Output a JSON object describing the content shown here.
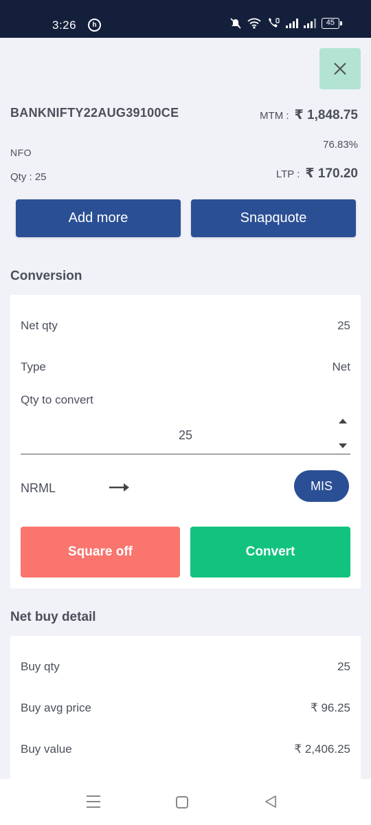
{
  "status_bar": {
    "time": "3:26",
    "app_icon_glyph": "h",
    "battery": "45",
    "icons": [
      "mute-icon",
      "wifi-icon",
      "call-icon",
      "signal-icon",
      "signal-icon",
      "battery-icon"
    ]
  },
  "header": {
    "close_icon": "close-icon",
    "symbol": "BANKNIFTY22AUG39100CE",
    "exchange": "NFO",
    "qty": "Qty : 25",
    "mtm_label": "MTM :",
    "mtm_value": "₹ 1,848.75",
    "change_pct": "76.83%",
    "ltp_label": "LTP :",
    "ltp_value": "₹ 170.20"
  },
  "actions": {
    "add_more": "Add more",
    "snapquote": "Snapquote"
  },
  "conversion": {
    "title": "Conversion",
    "net_qty_label": "Net qty",
    "net_qty_value": "25",
    "type_label": "Type",
    "type_value": "Net",
    "qty_to_convert_label": "Qty to convert",
    "qty_to_convert_value": "25",
    "from_product": "NRML",
    "to_product": "MIS",
    "square_off": "Square off",
    "convert": "Convert"
  },
  "net_buy": {
    "title": "Net buy detail",
    "rows": [
      {
        "label": "Buy qty",
        "value": "25"
      },
      {
        "label": "Buy avg price",
        "value": "₹ 96.25"
      },
      {
        "label": "Buy value",
        "value": "₹ 2,406.25"
      }
    ]
  },
  "colors": {
    "status_bar": "#14203b",
    "primary_blue": "#2b4f95",
    "close_bg": "#b3e4d3",
    "square_off": "#f9756e",
    "convert": "#12c37f",
    "page_bg": "#f1f2f7"
  }
}
